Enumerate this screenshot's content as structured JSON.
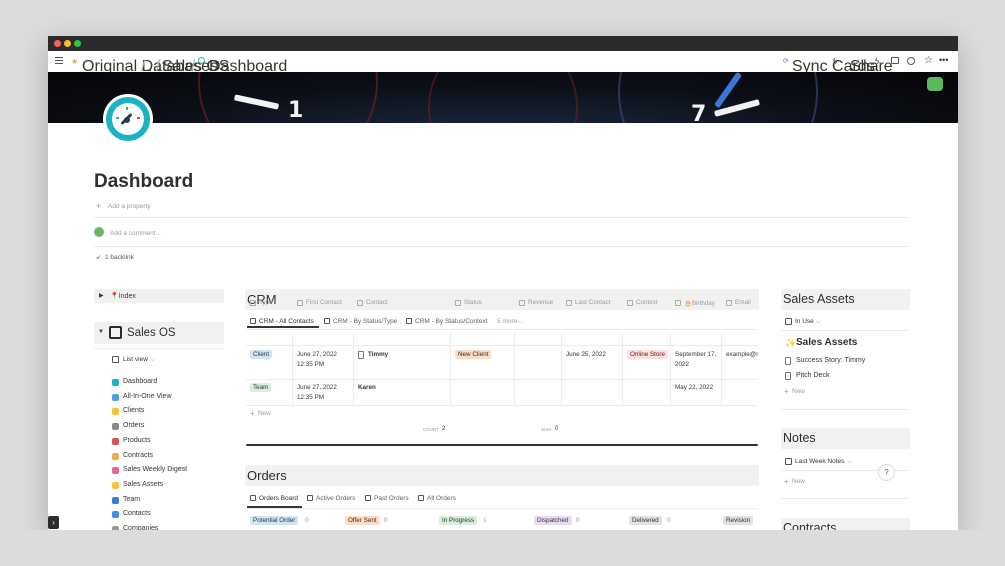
{
  "topbar": {
    "breadcrumb": [
      "Original Databases",
      "...",
      "Sales OS",
      "Dashboard"
    ],
    "sync_cards": "Sync Cards",
    "share": "Share"
  },
  "page": {
    "title": "Dashboard",
    "add_property": "Add a property",
    "add_comment": "Add a comment...",
    "backlink": "1 backlink"
  },
  "sidebar": {
    "index_label": "📍Index",
    "sales_os_label": "Sales OS",
    "view_label": "List view",
    "items": [
      {
        "label": "Dashboard",
        "color": "#1ab3c2"
      },
      {
        "label": "All-In-One View",
        "color": "#4aa3df"
      },
      {
        "label": "Clients",
        "color": "#f5c542"
      },
      {
        "label": "Orders",
        "color": "#8a8a8a"
      },
      {
        "label": "Products",
        "color": "#d9534f"
      },
      {
        "label": "Contracts",
        "color": "#e8b04a"
      },
      {
        "label": "Sales Weekly Digest",
        "color": "#e06c8a"
      },
      {
        "label": "Sales Assets",
        "color": "#f5c542"
      },
      {
        "label": "Team",
        "color": "#3a7bd5"
      },
      {
        "label": "Contacts",
        "color": "#4a8fdd"
      },
      {
        "label": "Companies",
        "color": "#999999"
      }
    ]
  },
  "crm": {
    "title": "CRM",
    "tabs": [
      "CRM - All Contacts",
      "CRM - By Status/Type",
      "CRM - By Status/Context",
      "5 more..."
    ],
    "columns": [
      "Type",
      "First Contact",
      "Contact",
      "Status",
      "Revenue",
      "Last Contact",
      "Context",
      "🎂Birthday",
      "Email"
    ],
    "rows": [
      {
        "type": "Client",
        "first_contact": "June 27, 2022 12:35 PM",
        "contact": "Timmy",
        "status": "New Client",
        "revenue": "",
        "last_contact": "June 25, 2022",
        "context": "Online Store",
        "birthday": "September 17, 2022",
        "email": "example@r"
      },
      {
        "type": "Team",
        "first_contact": "June 27, 2022 12:35 PM",
        "contact": "Karen",
        "status": "",
        "revenue": "",
        "last_contact": "",
        "context": "",
        "birthday": "May 22, 2022",
        "email": ""
      }
    ],
    "new_label": "New",
    "count_label": "COUNT",
    "count_value": "2",
    "sum_label": "SUM",
    "sum_value": "0"
  },
  "orders": {
    "title": "Orders",
    "tabs": [
      "Orders Board",
      "Active Orders",
      "Past Orders",
      "All Orders"
    ],
    "columns": [
      {
        "label": "Potential Order",
        "count": "0",
        "bg": "#d3e5ef",
        "fg": "#183347"
      },
      {
        "label": "Offer Sent",
        "count": "0",
        "bg": "#fadec9",
        "fg": "#49290e"
      },
      {
        "label": "In Progress",
        "count": "1",
        "bg": "#dbeddb",
        "fg": "#1c3829"
      },
      {
        "label": "Dispatched",
        "count": "0",
        "bg": "#e8deee",
        "fg": "#412454"
      },
      {
        "label": "Delivered",
        "count": "0",
        "bg": "#e3e2e0",
        "fg": "#32302c"
      },
      {
        "label": "Revision",
        "count": "",
        "bg": "#e3e2e0",
        "fg": "#32302c"
      }
    ]
  },
  "sales_assets": {
    "title": "Sales Assets",
    "view_label": "In Use",
    "heading": "Sales Assets",
    "items": [
      "Success Story: Timmy",
      "Pitch Deck"
    ],
    "new_label": "New"
  },
  "notes": {
    "title": "Notes",
    "view_label": "Last Week Notes",
    "new_label": "New"
  },
  "contracts": {
    "title": "Contracts"
  },
  "help_label": "?"
}
